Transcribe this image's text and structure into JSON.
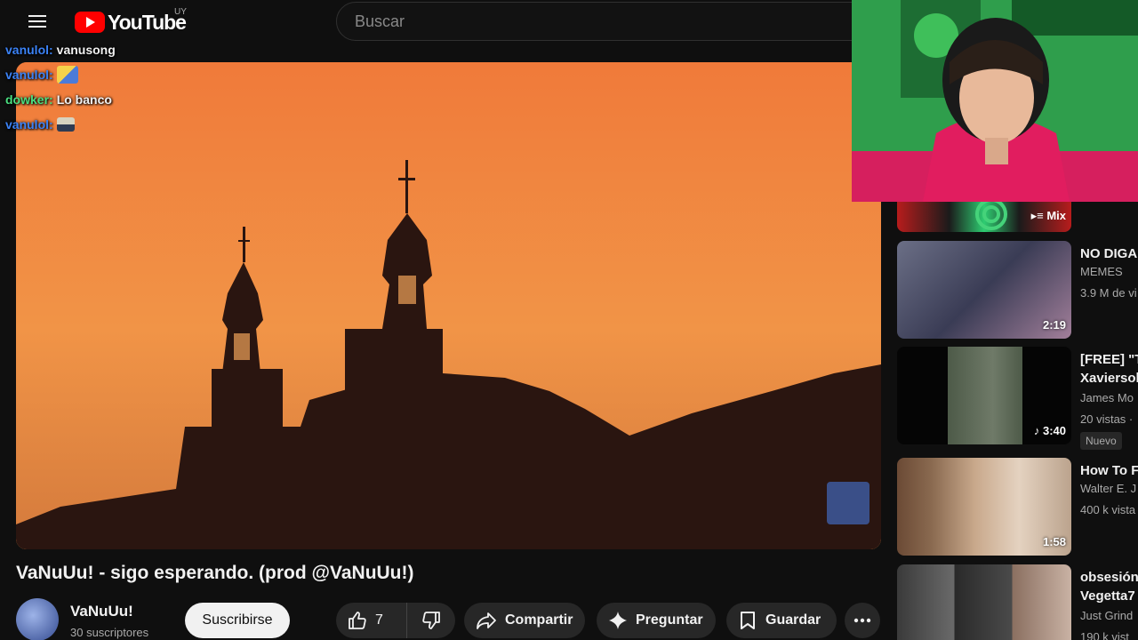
{
  "header": {
    "logo_text": "YouTube",
    "country_code": "UY",
    "search_placeholder": "Buscar"
  },
  "chat": [
    {
      "user": "vanulol:",
      "message": "vanusong",
      "emote": null
    },
    {
      "user": "vanulol:",
      "message": "",
      "emote": "emote-a"
    },
    {
      "user": "dowker:",
      "message": "Lo banco",
      "emote": null
    },
    {
      "user": "vanulol:",
      "message": "",
      "emote": "emote-b"
    }
  ],
  "video": {
    "title": "VaNuUu! - sigo esperando. (prod @VaNuUu!)",
    "channel_name": "VaNuUu!",
    "subscribers": "30 suscriptores",
    "subscribe_label": "Suscribirse",
    "like_count": "7",
    "share_label": "Compartir",
    "ask_label": "Preguntar",
    "save_label": "Guardar"
  },
  "sidebar": {
    "mix_label": "Mix",
    "items": [
      {
        "title": "NO DIGA",
        "channel": "MEMES",
        "views": "3.9 M de vi",
        "duration": "2:19",
        "badge": ""
      },
      {
        "title": "[FREE] \"T",
        "title2": "Xaviersol",
        "channel": "James Mo",
        "views": "20 vistas ·",
        "duration": "3:40",
        "badge": "Nuevo"
      },
      {
        "title": "How To F",
        "channel": "Walter E. J",
        "views": "400 k vista",
        "duration": "1:58",
        "badge": ""
      },
      {
        "title": "obsesión",
        "title2": "Vegetta7",
        "channel": "Just Grind",
        "views": "190 k vist",
        "duration": "",
        "badge": ""
      }
    ]
  },
  "colors": {
    "background": "#0f0f0f",
    "brand_red": "#ff0000",
    "chat_user_blue": "#3b82f6",
    "chat_user_green": "#4ade80",
    "sky_orange": "#e88a3f"
  }
}
